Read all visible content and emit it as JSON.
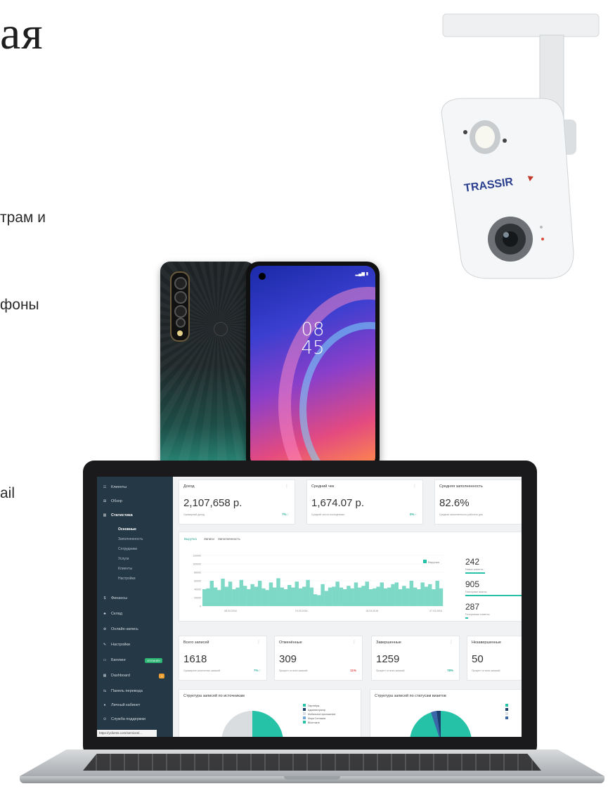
{
  "left_text": {
    "heading": "ая",
    "line1": "трам и",
    "line2": "фоны",
    "line3": "ail"
  },
  "camera": {
    "brand": "TRASSIR"
  },
  "phone": {
    "clock_hour": "08",
    "clock_min": "45"
  },
  "dashboard": {
    "sidebar": {
      "items": [
        {
          "label": "Клиенты",
          "icon": "users-icon",
          "glyph": "☷"
        },
        {
          "label": "Обзор",
          "icon": "grid-icon",
          "glyph": "⊞"
        },
        {
          "label": "Статистика",
          "icon": "chart-icon",
          "glyph": "▥"
        }
      ],
      "stat_sub": [
        "Основные",
        "Заполненность",
        "Сотрудники",
        "Услуги",
        "Клиенты",
        "Настройки"
      ],
      "items2": [
        {
          "label": "Финансы",
          "icon": "money-icon",
          "glyph": "$"
        },
        {
          "label": "Склад",
          "icon": "warehouse-icon",
          "glyph": "♣"
        },
        {
          "label": "Онлайн-запись",
          "icon": "online-icon",
          "glyph": "⊕"
        },
        {
          "label": "Настройки",
          "icon": "settings-icon",
          "glyph": "✎"
        },
        {
          "label": "Биллинг",
          "icon": "billing-icon",
          "glyph": "▭"
        },
        {
          "label": "Dashboard",
          "icon": "dashboard-icon",
          "glyph": "▦"
        },
        {
          "label": "Панель перевода",
          "icon": "transfer-icon",
          "glyph": "⇆"
        },
        {
          "label": "Личный кабинет",
          "icon": "account-icon",
          "glyph": "♦"
        },
        {
          "label": "Служба поддержки",
          "icon": "support-icon",
          "glyph": "⊙"
        }
      ],
      "billing_badge": "ОПЛАЧЕН",
      "dashboard_badge": "1",
      "url": "https://yclients.com/services/..."
    },
    "cards_top": [
      {
        "title": "Доход",
        "value": "2,107,658 р.",
        "sub": "Суммарный доход",
        "pct": "7% ↑"
      },
      {
        "title": "Средний чек",
        "value": "1,674.07 р.",
        "sub": "Средний чек по посещениям",
        "pct": "0% ↑"
      },
      {
        "title": "Средняя заполненность",
        "value": "82.6%",
        "sub": "Средняя заполненность рабочего дня",
        "pct": ""
      }
    ],
    "chart_tabs": [
      "Выручка",
      "Записи",
      "Заполненность"
    ],
    "legend": "Выручка",
    "side_stats": [
      {
        "value": "242",
        "label": "Новые клиенты",
        "fill": 0.35
      },
      {
        "value": "905",
        "label": "Повторные визиты",
        "fill": 1.0
      },
      {
        "value": "287",
        "label": "Потерянные клиенты",
        "fill": 0.05
      }
    ],
    "cards_bottom": [
      {
        "title": "Всего записей",
        "value": "1618",
        "sub": "Суммарное количество записей",
        "pct": "7% ↑",
        "red": false
      },
      {
        "title": "Отменённые",
        "value": "309",
        "sub": "Процент от всех записей",
        "pct": "11%",
        "red": true
      },
      {
        "title": "Завершенные",
        "value": "1259",
        "sub": "Процент от всех записей",
        "pct": "78%",
        "red": false
      },
      {
        "title": "Незавершенные",
        "value": "50",
        "sub": "Процент от всех записей",
        "pct": "",
        "red": false
      }
    ],
    "structure_left": {
      "title": "Структура записей по источникам",
      "legend": [
        "Партнёры",
        "Администратор",
        "Мобильное приложение",
        "Моря Сотников",
        "ВКонтакте"
      ]
    },
    "structure_right": {
      "title": "Структура записей по статусам визитов"
    },
    "colors": {
      "accent": "#26c2a7",
      "sidebar": "#253846",
      "bars": "#7ed8c6"
    }
  },
  "chart_data": {
    "type": "bar",
    "title": "",
    "series": [
      {
        "name": "Выручка",
        "values": [
          40000,
          42000,
          60000,
          44000,
          38000,
          65000,
          46000,
          58000,
          40000,
          44000,
          62000,
          48000,
          40000,
          52000,
          46000,
          60000,
          42000,
          38000,
          56000,
          44000,
          66000,
          44000,
          40000,
          50000,
          44000,
          58000,
          42000,
          46000,
          62000,
          44000,
          28000,
          26000,
          52000,
          36000,
          44000,
          46000,
          58000,
          44000,
          40000,
          48000,
          42000,
          56000,
          44000,
          48000,
          58000,
          40000,
          42000,
          46000,
          56000,
          42000,
          44000,
          52000,
          56000,
          40000,
          48000,
          42000,
          60000,
          44000,
          40000,
          56000,
          46000,
          52000,
          40000,
          60000,
          42000
        ]
      }
    ],
    "yticks": [
      "0",
      "20000",
      "40000",
      "60000",
      "80000",
      "100000",
      "120000"
    ],
    "xticks": [
      "08.03.2016",
      "19.03.2016",
      "04.03.2016",
      "07.03.2016"
    ],
    "ylim": [
      0,
      120000
    ]
  }
}
